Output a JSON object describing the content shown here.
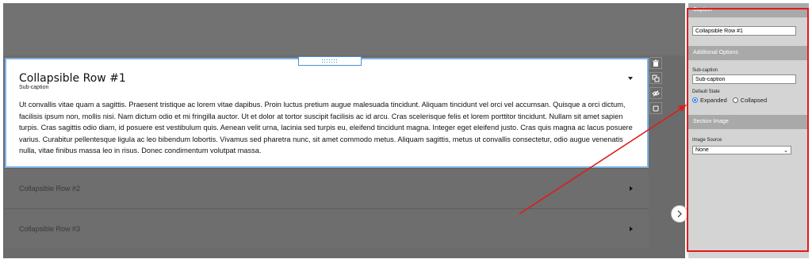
{
  "canvas": {
    "active_row": {
      "title": "Collapsible Row #1",
      "sub_caption": "Sub-caption",
      "body": "Ut convallis vitae quam a sagittis. Praesent tristique ac lorem vitae dapibus. Proin luctus pretium augue malesuada tincidunt. Aliquam tincidunt vel orci vel accumsan. Quisque a orci dictum, facilisis ipsum non, mollis nisi. Nam dictum odio et mi fringilla auctor. Ut et dolor at tortor suscipit facilisis ac id arcu. Cras scelerisque felis et lorem porttitor tincidunt. Nullam sit amet sapien turpis. Cras sagittis odio diam, id posuere est vestibulum quis. Aenean velit urna, lacinia sed turpis eu, eleifend tincidunt magna. Integer eget eleifend justo. Cras quis magna ac lacus posuere varius. Curabitur pellentesque ligula ac leo bibendum lobortis. Vivamus sed pharetra nunc, sit amet commodo metus. Aliquam sagittis, metus ut convallis consectetur, odio augue venenatis nulla, vitae finibus massa leo in risus. Donec condimentum volutpat massa."
    },
    "collapsed_rows": [
      {
        "title": "Collapsible Row #2"
      },
      {
        "title": "Collapsible Row #3"
      }
    ],
    "toolbar_icons": [
      "trash-icon",
      "duplicate-icon",
      "hide-icon",
      "square-icon"
    ]
  },
  "panel": {
    "caption_header": "Caption",
    "caption_value": "Collapsible Row #1",
    "additional_header": "Additional Options",
    "subcaption_label": "Sub-caption",
    "subcaption_value": "Sub-caption",
    "default_state_label": "Default State",
    "state_options": [
      "Expanded",
      "Collapsed"
    ],
    "selected_state": "Expanded",
    "section_image_header": "Section Image",
    "image_source_label": "Image Source",
    "image_source_value": "None"
  },
  "colors": {
    "highlight": "#e01b1b",
    "selection": "#7fb3e6",
    "panel_header": "#a9a9a9"
  }
}
